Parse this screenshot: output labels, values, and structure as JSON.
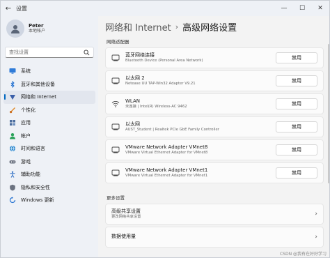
{
  "window": {
    "title": "设置",
    "back_icon": "back-arrow-icon"
  },
  "controls": {
    "minimize": "—",
    "maximize": "☐",
    "close": "✕"
  },
  "profile": {
    "name": "Peter",
    "account": "本地帐户"
  },
  "search": {
    "placeholder": "查找设置"
  },
  "sidebar": {
    "items": [
      {
        "label": "系统",
        "icon": "monitor-icon"
      },
      {
        "label": "蓝牙和其他设备",
        "icon": "bluetooth-icon"
      },
      {
        "label": "网络和 Internet",
        "icon": "network-icon",
        "active": true
      },
      {
        "label": "个性化",
        "icon": "brush-icon"
      },
      {
        "label": "应用",
        "icon": "apps-icon"
      },
      {
        "label": "帐户",
        "icon": "person-icon"
      },
      {
        "label": "时间和语言",
        "icon": "globe-icon"
      },
      {
        "label": "游戏",
        "icon": "gamepad-icon"
      },
      {
        "label": "辅助功能",
        "icon": "accessibility-icon"
      },
      {
        "label": "隐私和安全性",
        "icon": "shield-icon"
      },
      {
        "label": "Windows 更新",
        "icon": "update-icon"
      }
    ]
  },
  "breadcrumb": {
    "parent": "网络和 Internet",
    "sep": "›",
    "current": "高级网络设置"
  },
  "adapters_label": "网络适配器",
  "adapters": [
    {
      "title": "蓝牙网络连接",
      "sub": "Bluetooth Device (Personal Area Network)",
      "button": "禁用",
      "icon": "adapter-icon"
    },
    {
      "title": "以太网 2",
      "sub": "Netease UU TAP-Win32 Adapter V9.21",
      "button": "禁用",
      "icon": "adapter-icon"
    },
    {
      "title": "WLAN",
      "sub": "未连接 | Intel(R) Wireless-AC 9462",
      "button": "禁用",
      "icon": "wifi-icon"
    },
    {
      "title": "以太网",
      "sub": "AUST_Student | Realtek PCIe GbE Family Controller",
      "button": "禁用",
      "icon": "adapter-icon"
    },
    {
      "title": "VMware Network Adapter VMnet8",
      "sub": "VMware Virtual Ethernet Adapter for VMnet8",
      "button": "禁用",
      "icon": "adapter-icon"
    },
    {
      "title": "VMware Network Adapter VMnet1",
      "sub": "VMware Virtual Ethernet Adapter for VMnet1",
      "button": "禁用",
      "icon": "adapter-icon"
    }
  ],
  "more_label": "更多设置",
  "more": [
    {
      "title": "高级共享设置",
      "sub": "更改网络共享设置",
      "chev": "›"
    },
    {
      "title": "数据使用量",
      "sub": "",
      "chev": "›"
    }
  ],
  "watermark": "CSDN @我有在好好学习",
  "colors": {
    "accent": "#0067c0",
    "background": "#f3f3f3",
    "card": "#fbfbfb"
  }
}
